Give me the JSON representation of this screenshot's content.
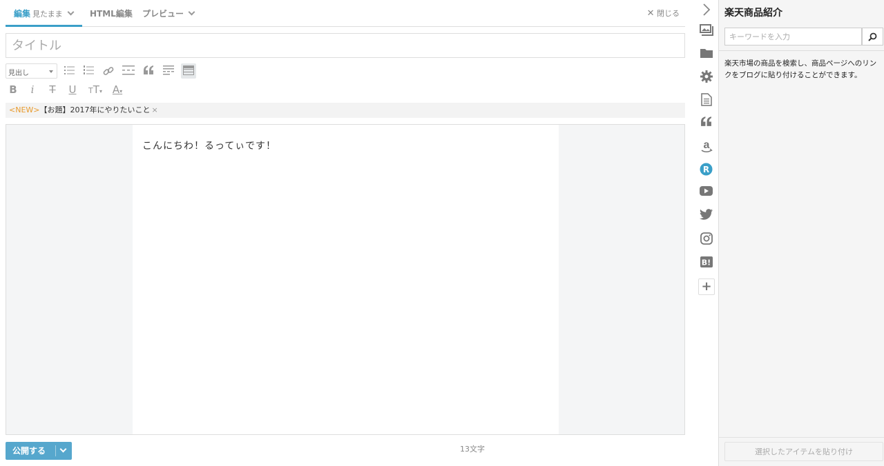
{
  "tabs": {
    "edit_label": "編集",
    "edit_mode": "見たまま",
    "html_label": "HTML編集",
    "preview_label": "プレビュー",
    "close_label": "閉じる"
  },
  "title_input": {
    "placeholder": "タイトル",
    "value": ""
  },
  "toolbar": {
    "heading_select": "見出し"
  },
  "tag": {
    "new_label": "<NEW>",
    "text": "【お題】2017年にやりたいこと",
    "remove": "×"
  },
  "content": {
    "text": "こんにちわ！るってぃです！"
  },
  "footer": {
    "publish_label": "公開する",
    "char_count": "13文字"
  },
  "panel": {
    "title": "楽天商品紹介",
    "search_placeholder": "キーワードを入力",
    "description": "楽天市場の商品を検索し、商品ページへのリンクをブログに貼り付けることができます。",
    "paste_label": "選択したアイテムを貼り付け"
  },
  "sidebar_icons": [
    "collapse-icon",
    "photo-icon",
    "folder-icon",
    "gear-icon",
    "document-icon",
    "quote-icon",
    "amazon-icon",
    "rakuten-icon",
    "youtube-icon",
    "twitter-icon",
    "instagram-icon",
    "hatena-bookmark-icon",
    "plus-icon"
  ],
  "colors": {
    "accent": "#3a9fc8",
    "publish": "#56a7cd",
    "new_tag": "#e89b2e",
    "rakuten": "#3a9fc8",
    "icon": "#777777"
  }
}
